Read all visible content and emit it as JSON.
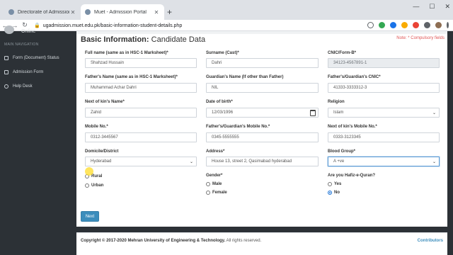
{
  "browser": {
    "tabs": [
      {
        "title": "Directorate of Admissions"
      },
      {
        "title": "Muet - Admission Portal"
      }
    ],
    "url": "ugadmission.muet.edu.pk/basic-information-student-details.php"
  },
  "sidebar": {
    "brand": "Online",
    "nav_label": "MAIN NAVIGATION",
    "items": [
      {
        "label": "Form (Document) Status"
      },
      {
        "label": "Admission Form"
      },
      {
        "label": "Help Desk"
      }
    ]
  },
  "page": {
    "heading_bold": "Basic Information:",
    "heading_rest": " Candidate Data",
    "note": "Note: * Compulsory fields"
  },
  "form": {
    "full_name": {
      "label": "Full name (same as in HSC-1 Marksheet)*",
      "value": "Shahzad Hussain"
    },
    "surname": {
      "label": "Surname (Cast)*",
      "value": "Dahri"
    },
    "cnic": {
      "label": "CNIC/Form-B*",
      "value": "34123-4567891-1"
    },
    "father_name": {
      "label": "Father's Name (same as in HSC-1 Marksheet)*",
      "value": "Muhammad Achar Dahri"
    },
    "guardian_name": {
      "label": "Guardian's Name (If other than Father)",
      "value": "NIL"
    },
    "guardian_cnic": {
      "label": "Father's/Guardian's CNIC*",
      "value": "41333-3333312-3"
    },
    "next_of_kin": {
      "label": "Next of kin's Name*",
      "value": "Zahid"
    },
    "dob": {
      "label": "Date of birth*",
      "value": "12/03/1996"
    },
    "religion": {
      "label": "Religion",
      "value": "Islam"
    },
    "mobile": {
      "label": "Mobile No.*",
      "value": "0312-3445567"
    },
    "guardian_mobile": {
      "label": "Father's/Guardian's Mobile No.*",
      "value": "0345-5555555"
    },
    "kin_mobile": {
      "label": "Next of kin's Mobile No.*",
      "value": "0333-3123345"
    },
    "domicile": {
      "label": "Domicile/District",
      "value": "Hyderabad"
    },
    "address": {
      "label": "Address*",
      "value": "House 13, street 2, Qasimabad hyderabad"
    },
    "blood_group": {
      "label": "Blood Group*",
      "value": "A +ve"
    },
    "area": {
      "options": [
        "Rural",
        "Urban"
      ]
    },
    "gender": {
      "label": "Gender*",
      "options": [
        "Male",
        "Female"
      ]
    },
    "hafiz": {
      "label": "Are you Hafiz-e-Quran?",
      "options": [
        "Yes",
        "No"
      ],
      "selected": "No"
    },
    "next_label": "Next"
  },
  "footer": {
    "copyright": "Copyright © 2017-2020 Mehran University of Engineering & Technology.",
    "rights": " All rights reserved.",
    "contributors": "Contributors"
  },
  "colors": {
    "primary": "#3c8dbc",
    "sidebar": "#2c3136",
    "note": "#e05555"
  }
}
